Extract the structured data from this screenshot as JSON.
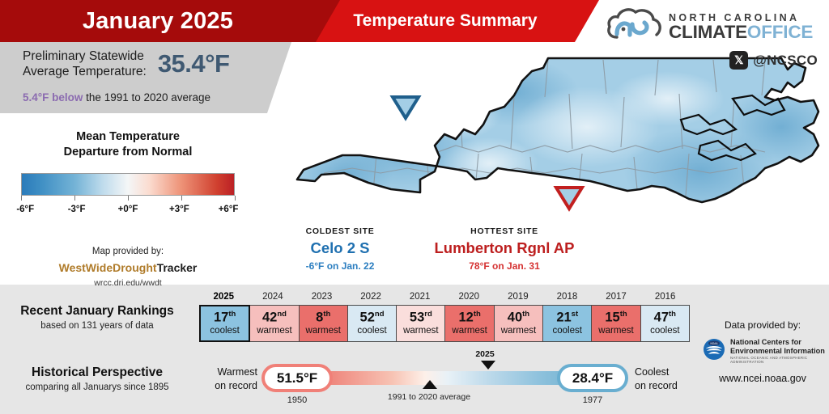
{
  "header": {
    "month_title": "January 2025",
    "summary_title": "Temperature Summary"
  },
  "logo": {
    "line1": "NORTH CAROLINA",
    "line2_bold": "CLIMATE",
    "line2_light": "OFFICE",
    "social_icon": "x-twitter-icon",
    "handle": "@NCSCO"
  },
  "stat": {
    "label_line1": "Preliminary Statewide",
    "label_line2": "Average Temperature:",
    "value": "35.4°F",
    "departure": "5.4°F below",
    "departure_rest": " the 1991 to 2020 average",
    "value_color": "#3f5972",
    "departure_color": "#8b6bb0"
  },
  "legend": {
    "title_line1": "Mean Temperature",
    "title_line2": "Departure from Normal",
    "ticks": [
      "-6°F",
      "-3°F",
      "+0°F",
      "+3°F",
      "+6°F"
    ],
    "tick_positions": [
      0,
      25,
      50,
      75,
      100
    ],
    "cold_color": "#2b7bba",
    "warm_color": "#bb2025",
    "credit_intro": "Map provided by:",
    "credit_brand_a": "WestWideDrought",
    "credit_brand_b": "Tracker",
    "credit_url": "wrcc.dri.edu/wwdt"
  },
  "map": {
    "state": "North Carolina",
    "cold_marker": "triangle-down-marker",
    "hot_marker": "triangle-up-marker"
  },
  "sites": {
    "coldest": {
      "kicker": "COLDEST SITE",
      "name": "Celo 2 S",
      "detail": "-6°F on Jan. 22",
      "color": "#1f70b0"
    },
    "hottest": {
      "kicker": "HOTTEST SITE",
      "name": "Lumberton Rgnl AP",
      "detail": "78°F on Jan. 31",
      "color": "#bd1f1f"
    }
  },
  "rankings": {
    "title": "Recent January Rankings",
    "subtitle": "based on 131 years of data",
    "items": [
      {
        "year": "2025",
        "rank": "17",
        "ord": "th",
        "label": "coolest",
        "color": "#8cc3e0",
        "current": true
      },
      {
        "year": "2024",
        "rank": "42",
        "ord": "nd",
        "label": "warmest",
        "color": "#f6bfbd",
        "current": false
      },
      {
        "year": "2023",
        "rank": "8",
        "ord": "th",
        "label": "warmest",
        "color": "#ea6f6b",
        "current": false
      },
      {
        "year": "2022",
        "rank": "52",
        "ord": "nd",
        "label": "coolest",
        "color": "#d9e9f3",
        "current": false
      },
      {
        "year": "2021",
        "rank": "53",
        "ord": "rd",
        "label": "warmest",
        "color": "#fadedc",
        "current": false
      },
      {
        "year": "2020",
        "rank": "12",
        "ord": "th",
        "label": "warmest",
        "color": "#ea6f6b",
        "current": false
      },
      {
        "year": "2019",
        "rank": "40",
        "ord": "th",
        "label": "warmest",
        "color": "#f6bfbd",
        "current": false
      },
      {
        "year": "2018",
        "rank": "21",
        "ord": "st",
        "label": "coolest",
        "color": "#8cc3e0",
        "current": false
      },
      {
        "year": "2017",
        "rank": "15",
        "ord": "th",
        "label": "warmest",
        "color": "#ea6f6b",
        "current": false
      },
      {
        "year": "2016",
        "rank": "47",
        "ord": "th",
        "label": "coolest",
        "color": "#d9e9f3",
        "current": false
      }
    ]
  },
  "historical": {
    "title": "Historical Perspective",
    "subtitle": "comparing all Januarys since 1895",
    "warmest_caption_line1": "Warmest",
    "warmest_caption_line2": "on record",
    "warmest_value": "51.5°F",
    "warmest_year": "1950",
    "coolest_caption_line1": "Coolest",
    "coolest_caption_line2": "on record",
    "coolest_value": "28.4°F",
    "coolest_year": "1977",
    "average_label": "1991 to 2020 average",
    "current_label": "2025"
  },
  "attribution": {
    "intro": "Data provided by:",
    "org_line1": "National Centers for",
    "org_line2": "Environmental Information",
    "org_sub": "NATIONAL OCEANIC AND ATMOSPHERIC ADMINISTRATION",
    "url": "www.ncei.noaa.gov"
  }
}
